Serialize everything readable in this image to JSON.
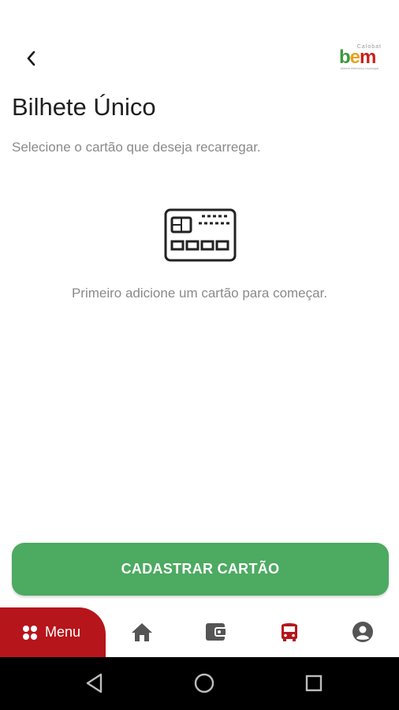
{
  "header": {
    "back_label": "back",
    "brand": {
      "top": "Calobat",
      "b": "b",
      "e": "e",
      "m": "m",
      "tagline": "bilhete eletrônico municipal"
    }
  },
  "main": {
    "title": "Bilhete Único",
    "subtitle": "Selecione o cartão que deseja recarregar.",
    "empty_icon": "credit-card-icon",
    "empty_message": "Primeiro adicione um cartão para começar."
  },
  "actions": {
    "register_card": "CADASTRAR CARTÃO"
  },
  "bottom_nav": {
    "menu_label": "Menu",
    "items": [
      {
        "icon": "home-icon"
      },
      {
        "icon": "wallet-icon"
      },
      {
        "icon": "bus-icon",
        "active": true
      },
      {
        "icon": "account-icon"
      }
    ],
    "active_color": "#b5151b",
    "icon_color": "#555555"
  },
  "colors": {
    "primary": "#4caa61",
    "accent": "#b5151b",
    "text_muted": "#8a8a8a"
  }
}
